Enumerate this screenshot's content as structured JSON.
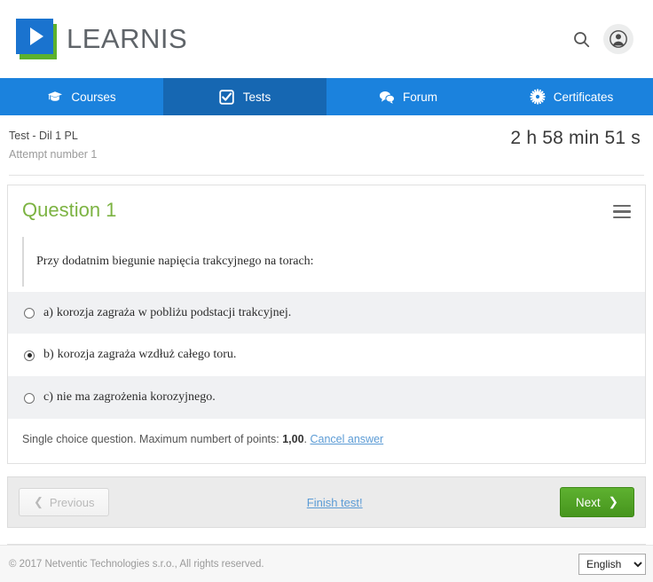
{
  "header": {
    "brand_name": "LEARNIS",
    "search_icon": "search-icon",
    "avatar_icon": "user-avatar-icon"
  },
  "nav": {
    "items": [
      {
        "label": "Courses",
        "icon": "graduation-cap-icon",
        "active": false
      },
      {
        "label": "Tests",
        "icon": "checkbox-checked-icon",
        "active": true
      },
      {
        "label": "Forum",
        "icon": "speech-bubbles-icon",
        "active": false
      },
      {
        "label": "Certificates",
        "icon": "certificate-seal-icon",
        "active": false
      }
    ]
  },
  "test": {
    "title": "Test - Dil 1 PL",
    "attempt": "Attempt number 1",
    "timer": "2 h 58 min 51 s"
  },
  "question": {
    "heading": "Question 1",
    "menu_icon": "hamburger-menu-icon",
    "text": "Przy dodatnim biegunie napięcia trakcyjnego na torach:",
    "answers": [
      {
        "letter": "a)",
        "text": "korozja zagraża w pobliżu podstacji trakcyjnej.",
        "selected": false,
        "shaded": true
      },
      {
        "letter": "b)",
        "text": "korozja zagraża wzdłuż całego toru.",
        "selected": true,
        "shaded": false
      },
      {
        "letter": "c)",
        "text": "nie ma zagrożenia korozyjnego.",
        "selected": false,
        "shaded": true
      }
    ],
    "meta_prefix": "Single choice question. Maximum numbert of points: ",
    "meta_points": "1,00",
    "meta_suffix": ". ",
    "cancel_answer_label": "Cancel answer"
  },
  "pager": {
    "previous_label": "Previous",
    "previous_icon": "chevron-left-icon",
    "finish_label": "Finish test!",
    "next_label": "Next",
    "next_icon": "chevron-right-icon"
  },
  "footer": {
    "copyright": "© 2017 Netventic Technologies s.r.o., All rights reserved.",
    "language_selected": "English",
    "language_options": [
      "English"
    ]
  },
  "colors": {
    "nav_blue": "#1b82dd",
    "nav_active_blue": "#1667b2",
    "brand_green": "#5cb12d",
    "brand_blue": "#1a73cf",
    "question_green": "#7cb342",
    "next_green": "#4f9e24",
    "link_blue": "#5b9bd5"
  }
}
